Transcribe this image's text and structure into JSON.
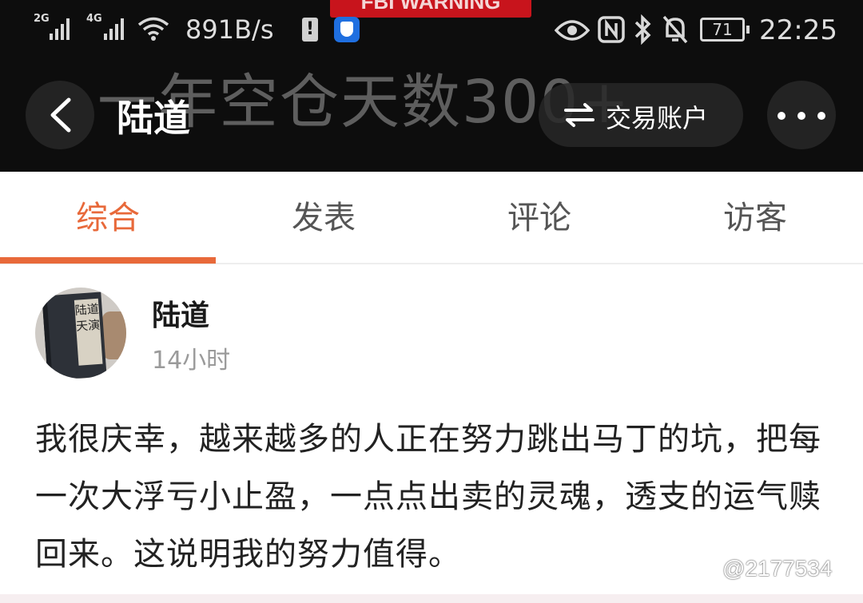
{
  "status_bar": {
    "sim1": "2G",
    "sim2": "4G",
    "speed": "891B/s",
    "battery": "71",
    "time": "22:25"
  },
  "banner": {
    "warning": "FBI WARNING",
    "background_text": "一年空仓天数300+"
  },
  "nav": {
    "title": "陆道",
    "account_button": "交易账户"
  },
  "tabs": [
    {
      "label": "综合",
      "active": true
    },
    {
      "label": "发表",
      "active": false
    },
    {
      "label": "评论",
      "active": false
    },
    {
      "label": "访客",
      "active": false
    }
  ],
  "post": {
    "avatar_text": "陆道天演",
    "author": "陆道",
    "time": "14小时",
    "content": "我很庆幸，越来越多的人正在努力跳出马丁的坑，把每一次大浮亏小止盈，一点点出卖的灵魂，透支的运气赎回来。这说明我的努力值得。"
  },
  "watermark": "@2177534",
  "colors": {
    "accent": "#e8693a",
    "banner_bg": "#0d0d0d"
  }
}
